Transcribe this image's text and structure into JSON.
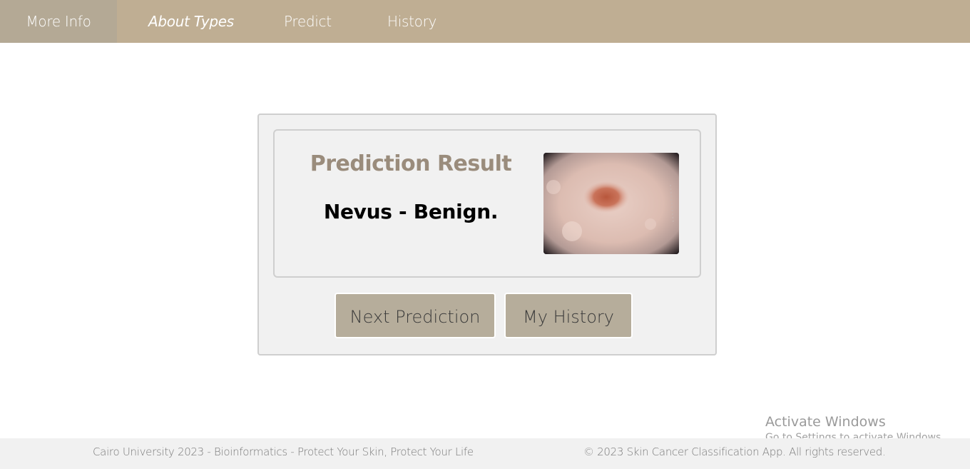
{
  "nav": {
    "items": [
      {
        "label": "More Info"
      },
      {
        "label": "About Types"
      },
      {
        "label": "Predict"
      },
      {
        "label": "History"
      }
    ]
  },
  "result": {
    "title": "Prediction Result",
    "value": "Nevus - Benign."
  },
  "actions": {
    "next_label": "Next Prediction",
    "history_label": "My History"
  },
  "watermark": {
    "title": "Activate Windows",
    "subtitle": "Go to Settings to activate Windows."
  },
  "footer": {
    "left": "Cairo University 2023 - Bioinformatics - Protect Your Skin, Protect Your Life",
    "right": "© 2023 Skin Cancer Classification App. All rights reserved."
  },
  "colors": {
    "navbar": "#bfae93",
    "nav_active": "#b4a995",
    "title": "#9a8c7c",
    "button": "#b6ad9b",
    "card": "#f1f1f1"
  }
}
